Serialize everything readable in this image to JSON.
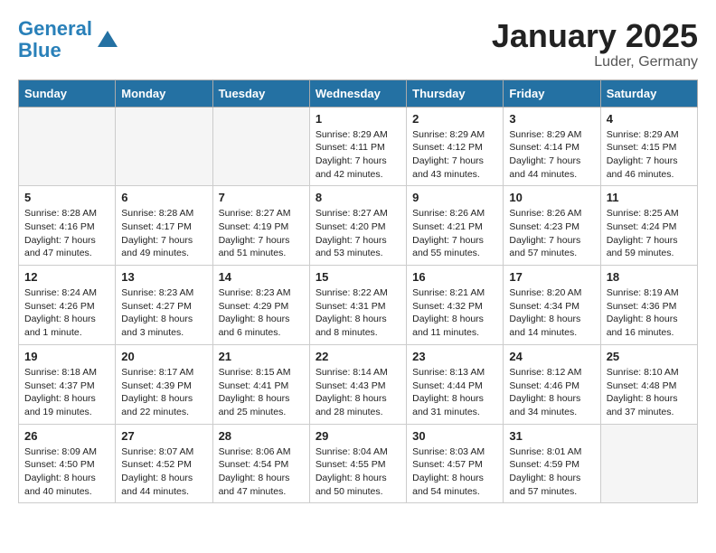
{
  "header": {
    "logo_line1": "General",
    "logo_line2": "Blue",
    "month": "January 2025",
    "location": "Luder, Germany"
  },
  "weekdays": [
    "Sunday",
    "Monday",
    "Tuesday",
    "Wednesday",
    "Thursday",
    "Friday",
    "Saturday"
  ],
  "weeks": [
    [
      {
        "day": "",
        "empty": true
      },
      {
        "day": "",
        "empty": true
      },
      {
        "day": "",
        "empty": true
      },
      {
        "day": "1",
        "sunrise": "8:29 AM",
        "sunset": "4:11 PM",
        "daylight": "7 hours and 42 minutes."
      },
      {
        "day": "2",
        "sunrise": "8:29 AM",
        "sunset": "4:12 PM",
        "daylight": "7 hours and 43 minutes."
      },
      {
        "day": "3",
        "sunrise": "8:29 AM",
        "sunset": "4:14 PM",
        "daylight": "7 hours and 44 minutes."
      },
      {
        "day": "4",
        "sunrise": "8:29 AM",
        "sunset": "4:15 PM",
        "daylight": "7 hours and 46 minutes."
      }
    ],
    [
      {
        "day": "5",
        "sunrise": "8:28 AM",
        "sunset": "4:16 PM",
        "daylight": "7 hours and 47 minutes."
      },
      {
        "day": "6",
        "sunrise": "8:28 AM",
        "sunset": "4:17 PM",
        "daylight": "7 hours and 49 minutes."
      },
      {
        "day": "7",
        "sunrise": "8:27 AM",
        "sunset": "4:19 PM",
        "daylight": "7 hours and 51 minutes."
      },
      {
        "day": "8",
        "sunrise": "8:27 AM",
        "sunset": "4:20 PM",
        "daylight": "7 hours and 53 minutes."
      },
      {
        "day": "9",
        "sunrise": "8:26 AM",
        "sunset": "4:21 PM",
        "daylight": "7 hours and 55 minutes."
      },
      {
        "day": "10",
        "sunrise": "8:26 AM",
        "sunset": "4:23 PM",
        "daylight": "7 hours and 57 minutes."
      },
      {
        "day": "11",
        "sunrise": "8:25 AM",
        "sunset": "4:24 PM",
        "daylight": "7 hours and 59 minutes."
      }
    ],
    [
      {
        "day": "12",
        "sunrise": "8:24 AM",
        "sunset": "4:26 PM",
        "daylight": "8 hours and 1 minute."
      },
      {
        "day": "13",
        "sunrise": "8:23 AM",
        "sunset": "4:27 PM",
        "daylight": "8 hours and 3 minutes."
      },
      {
        "day": "14",
        "sunrise": "8:23 AM",
        "sunset": "4:29 PM",
        "daylight": "8 hours and 6 minutes."
      },
      {
        "day": "15",
        "sunrise": "8:22 AM",
        "sunset": "4:31 PM",
        "daylight": "8 hours and 8 minutes."
      },
      {
        "day": "16",
        "sunrise": "8:21 AM",
        "sunset": "4:32 PM",
        "daylight": "8 hours and 11 minutes."
      },
      {
        "day": "17",
        "sunrise": "8:20 AM",
        "sunset": "4:34 PM",
        "daylight": "8 hours and 14 minutes."
      },
      {
        "day": "18",
        "sunrise": "8:19 AM",
        "sunset": "4:36 PM",
        "daylight": "8 hours and 16 minutes."
      }
    ],
    [
      {
        "day": "19",
        "sunrise": "8:18 AM",
        "sunset": "4:37 PM",
        "daylight": "8 hours and 19 minutes."
      },
      {
        "day": "20",
        "sunrise": "8:17 AM",
        "sunset": "4:39 PM",
        "daylight": "8 hours and 22 minutes."
      },
      {
        "day": "21",
        "sunrise": "8:15 AM",
        "sunset": "4:41 PM",
        "daylight": "8 hours and 25 minutes."
      },
      {
        "day": "22",
        "sunrise": "8:14 AM",
        "sunset": "4:43 PM",
        "daylight": "8 hours and 28 minutes."
      },
      {
        "day": "23",
        "sunrise": "8:13 AM",
        "sunset": "4:44 PM",
        "daylight": "8 hours and 31 minutes."
      },
      {
        "day": "24",
        "sunrise": "8:12 AM",
        "sunset": "4:46 PM",
        "daylight": "8 hours and 34 minutes."
      },
      {
        "day": "25",
        "sunrise": "8:10 AM",
        "sunset": "4:48 PM",
        "daylight": "8 hours and 37 minutes."
      }
    ],
    [
      {
        "day": "26",
        "sunrise": "8:09 AM",
        "sunset": "4:50 PM",
        "daylight": "8 hours and 40 minutes."
      },
      {
        "day": "27",
        "sunrise": "8:07 AM",
        "sunset": "4:52 PM",
        "daylight": "8 hours and 44 minutes."
      },
      {
        "day": "28",
        "sunrise": "8:06 AM",
        "sunset": "4:54 PM",
        "daylight": "8 hours and 47 minutes."
      },
      {
        "day": "29",
        "sunrise": "8:04 AM",
        "sunset": "4:55 PM",
        "daylight": "8 hours and 50 minutes."
      },
      {
        "day": "30",
        "sunrise": "8:03 AM",
        "sunset": "4:57 PM",
        "daylight": "8 hours and 54 minutes."
      },
      {
        "day": "31",
        "sunrise": "8:01 AM",
        "sunset": "4:59 PM",
        "daylight": "8 hours and 57 minutes."
      },
      {
        "day": "",
        "empty": true
      }
    ]
  ],
  "labels": {
    "sunrise": "Sunrise:",
    "sunset": "Sunset:",
    "daylight": "Daylight:"
  }
}
